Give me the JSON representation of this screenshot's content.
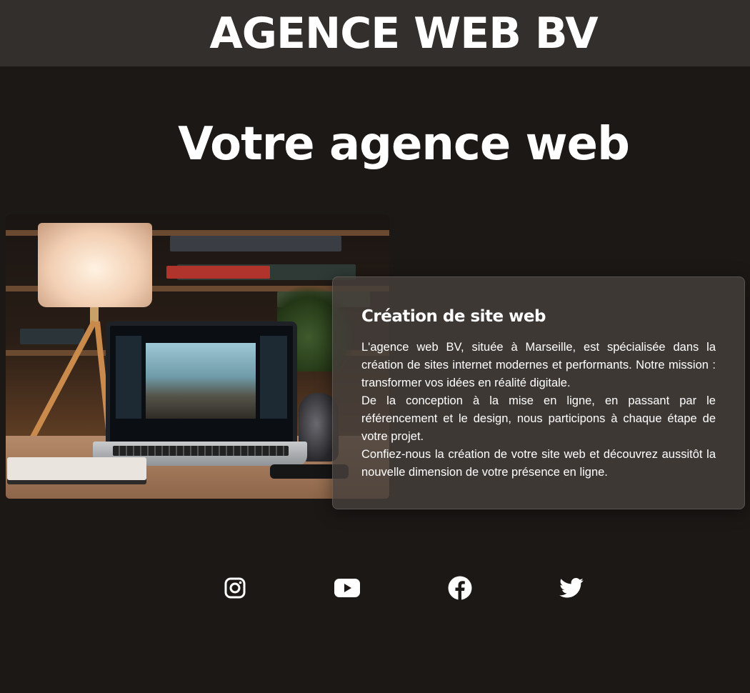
{
  "header": {
    "brand": "AGENCE WEB BV"
  },
  "hero": {
    "title": "Votre agence web"
  },
  "card": {
    "title": "Création de site web",
    "paragraphs": [
      "L'agence web BV, située à Marseille, est spécialisée dans la création de sites internet modernes et performants. Notre mission : transformer vos idées en réalité digitale.",
      "De la conception à la mise en ligne, en passant par le référencement et le design, nous participons à chaque étape de votre projet.",
      "Confiez-nous la création de votre site web et découvrez aussitôt la nouvelle dimension de votre présence en ligne."
    ]
  },
  "social": [
    {
      "icon": "instagram-icon"
    },
    {
      "icon": "youtube-icon"
    },
    {
      "icon": "facebook-icon"
    },
    {
      "icon": "twitter-icon"
    }
  ],
  "colors": {
    "background": "#1c1816",
    "header_bar": "#332f2d",
    "card_background": "#46403c",
    "text": "#ffffff"
  }
}
